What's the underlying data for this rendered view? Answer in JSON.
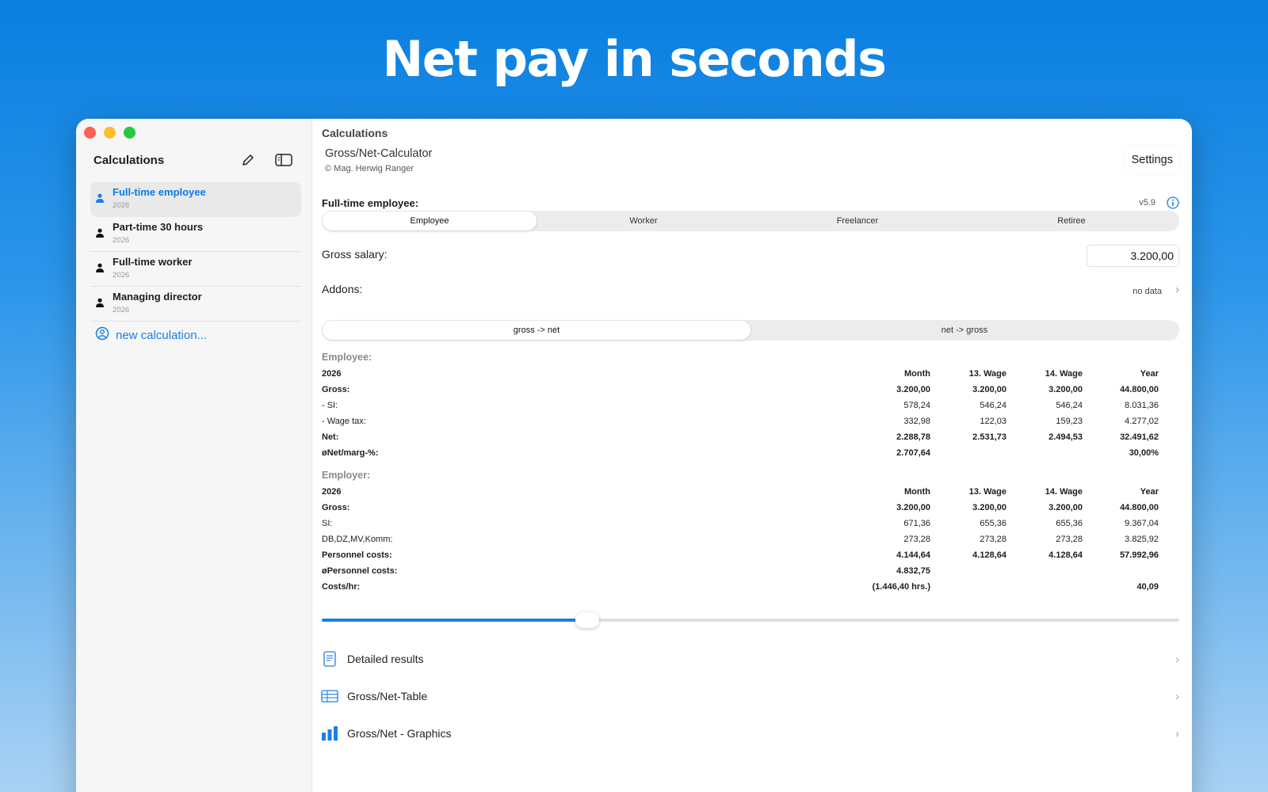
{
  "headline": "Net pay in seconds",
  "sidebar": {
    "title": "Calculations",
    "items": [
      {
        "name": "Full-time employee",
        "year": "2026"
      },
      {
        "name": "Part-time 30 hours",
        "year": "2026"
      },
      {
        "name": "Full-time worker",
        "year": "2026"
      },
      {
        "name": "Managing director",
        "year": "2026"
      }
    ],
    "new_calc": "new calculation..."
  },
  "main": {
    "title": "Calculations",
    "app_name": "Gross/Net-Calculator",
    "copyright": "© Mag. Herwig Ranger",
    "settings": "Settings",
    "section_label": "Full-time employee:",
    "version": "v5.9",
    "types": [
      "Employee",
      "Worker",
      "Freelancer",
      "Retiree"
    ],
    "gross_label": "Gross salary:",
    "gross_value": "3.200,00",
    "addons_label": "Addons:",
    "addons_value": "no data",
    "direction": [
      "gross -> net",
      "net -> gross"
    ],
    "employee": {
      "title": "Employee:",
      "header": [
        "2026",
        "Month",
        "13. Wage",
        "14. Wage",
        "Year"
      ],
      "rows": [
        {
          "label": "Gross:",
          "vals": [
            "3.200,00",
            "3.200,00",
            "3.200,00",
            "44.800,00"
          ],
          "bold": true
        },
        {
          "label": "- SI:",
          "vals": [
            "578,24",
            "546,24",
            "546,24",
            "8.031,36"
          ],
          "bold": false
        },
        {
          "label": "- Wage tax:",
          "vals": [
            "332,98",
            "122,03",
            "159,23",
            "4.277,02"
          ],
          "bold": false
        },
        {
          "label": "Net:",
          "vals": [
            "2.288,78",
            "2.531,73",
            "2.494,53",
            "32.491,62"
          ],
          "bold": true
        },
        {
          "label": "øNet/marg-%:",
          "vals": [
            "2.707,64",
            "",
            "",
            "30,00%"
          ],
          "bold": true
        }
      ]
    },
    "employer": {
      "title": "Employer:",
      "header": [
        "2026",
        "Month",
        "13. Wage",
        "14. Wage",
        "Year"
      ],
      "rows": [
        {
          "label": "Gross:",
          "vals": [
            "3.200,00",
            "3.200,00",
            "3.200,00",
            "44.800,00"
          ],
          "bold": true
        },
        {
          "label": "SI:",
          "vals": [
            "671,36",
            "655,36",
            "655,36",
            "9.367,04"
          ],
          "bold": false
        },
        {
          "label": "DB,DZ,MV,Komm:",
          "vals": [
            "273,28",
            "273,28",
            "273,28",
            "3.825,92"
          ],
          "bold": false
        },
        {
          "label": "Personnel costs:",
          "vals": [
            "4.144,64",
            "4.128,64",
            "4.128,64",
            "57.992,96"
          ],
          "bold": true
        },
        {
          "label": "øPersonnel costs:",
          "vals": [
            "4.832,75",
            "",
            "",
            ""
          ],
          "bold": true
        },
        {
          "label": "Costs/hr:",
          "vals": [
            "(1.446,40 hrs.)",
            "",
            "",
            "40,09"
          ],
          "bold": true
        }
      ]
    },
    "slider_value": 0.31,
    "nav": [
      "Detailed results",
      "Gross/Net-Table",
      "Gross/Net - Graphics"
    ]
  },
  "colors": {
    "accent": "#1a7fe8",
    "close": "#fe5f57",
    "minimize": "#febc2e",
    "zoom": "#28c840"
  }
}
